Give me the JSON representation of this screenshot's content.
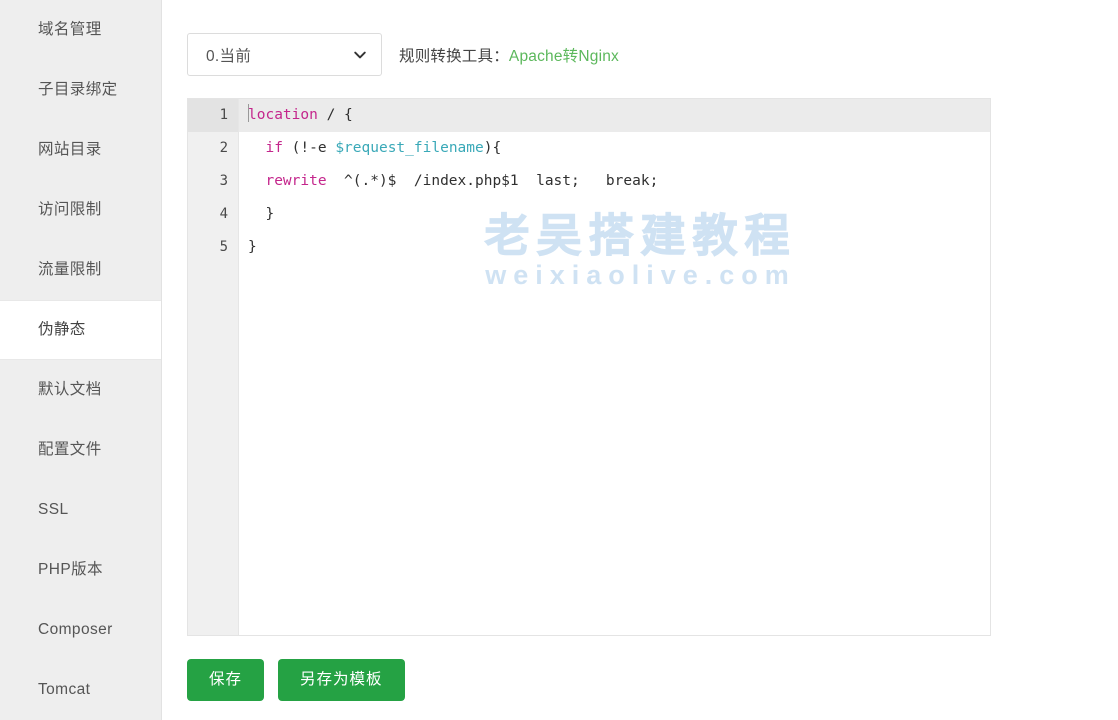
{
  "sidebar": {
    "items": [
      {
        "label": "域名管理",
        "active": false
      },
      {
        "label": "子目录绑定",
        "active": false
      },
      {
        "label": "网站目录",
        "active": false
      },
      {
        "label": "访问限制",
        "active": false
      },
      {
        "label": "流量限制",
        "active": false
      },
      {
        "label": "伪静态",
        "active": true
      },
      {
        "label": "默认文档",
        "active": false
      },
      {
        "label": "配置文件",
        "active": false
      },
      {
        "label": "SSL",
        "active": false
      },
      {
        "label": "PHP版本",
        "active": false
      },
      {
        "label": "Composer",
        "active": false
      },
      {
        "label": "Tomcat",
        "active": false
      }
    ]
  },
  "toolbar": {
    "rule_select": {
      "selected": "0.当前",
      "options": [
        "0.当前"
      ],
      "chevron_icon": "chevron-down-icon"
    },
    "converter_label": "规则转换工具：",
    "converter_link": "Apache转Nginx",
    "converter_link_color": "#5cb85c"
  },
  "editor": {
    "active_line": 1,
    "line_numbers": [
      "1",
      "2",
      "3",
      "4",
      "5"
    ],
    "lines": [
      {
        "n": "1",
        "tokens": [
          {
            "t": "location",
            "c": "kw"
          },
          {
            "t": " / {",
            "c": "pun"
          }
        ]
      },
      {
        "n": "2",
        "tokens": [
          {
            "t": "  ",
            "c": "pun"
          },
          {
            "t": "if",
            "c": "kw"
          },
          {
            "t": " (!-e ",
            "c": "pun"
          },
          {
            "t": "$request_filename",
            "c": "var"
          },
          {
            "t": "){",
            "c": "pun"
          }
        ]
      },
      {
        "n": "3",
        "tokens": [
          {
            "t": "  ",
            "c": "pun"
          },
          {
            "t": "rewrite",
            "c": "kw"
          },
          {
            "t": "  ^(.*)$  /index.php$1  last;   break;",
            "c": "pun"
          }
        ]
      },
      {
        "n": "4",
        "tokens": [
          {
            "t": "  }",
            "c": "pun"
          }
        ]
      },
      {
        "n": "5",
        "tokens": [
          {
            "t": "}",
            "c": "pun"
          }
        ]
      }
    ],
    "plain_text": "location / {\n  if (!-e $request_filename){\n  rewrite  ^(.*)$  /index.php$1  last;   break;\n  }\n}"
  },
  "watermark": {
    "line1": "老吴搭建教程",
    "line2": "weixiaolive.com",
    "color": "#cfe2f3"
  },
  "buttons": {
    "save": "保存",
    "save_as_template": "另存为模板",
    "color": "#25a244"
  }
}
